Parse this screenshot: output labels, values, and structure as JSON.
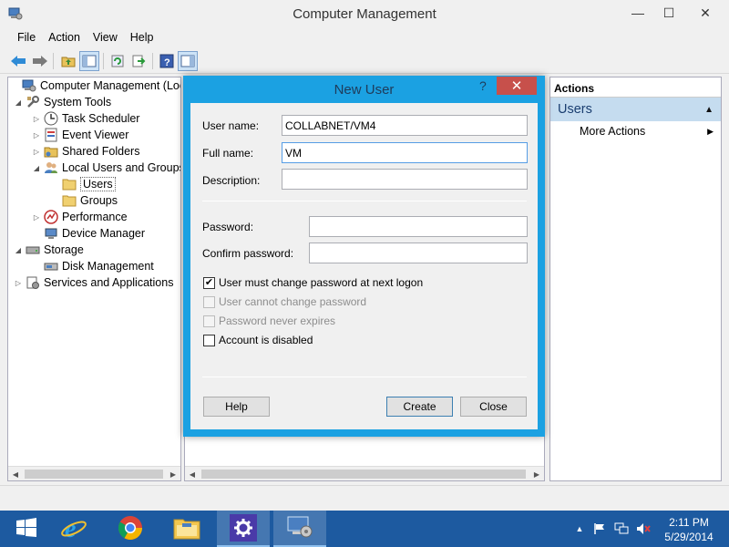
{
  "window": {
    "title": "Computer Management",
    "controls": {
      "minimize": "—",
      "maximize": "☐",
      "close": "✕"
    }
  },
  "menu": [
    "File",
    "Action",
    "View",
    "Help"
  ],
  "tree": {
    "items": [
      {
        "label": "Computer Management (Local",
        "level": 0,
        "arrow": "",
        "icon": "computer-management-icon"
      },
      {
        "label": "System Tools",
        "level": 0,
        "arrow": "◢",
        "icon": "tools-icon"
      },
      {
        "label": "Task Scheduler",
        "level": 1,
        "arrow": "▷",
        "icon": "clock-icon"
      },
      {
        "label": "Event Viewer",
        "level": 1,
        "arrow": "▷",
        "icon": "event-viewer-icon"
      },
      {
        "label": "Shared Folders",
        "level": 1,
        "arrow": "▷",
        "icon": "shared-folder-icon"
      },
      {
        "label": "Local Users and Groups",
        "level": 1,
        "arrow": "◢",
        "icon": "users-icon"
      },
      {
        "label": "Users",
        "level": 2,
        "arrow": "",
        "icon": "folder-icon",
        "selected": true
      },
      {
        "label": "Groups",
        "level": 2,
        "arrow": "",
        "icon": "folder-icon"
      },
      {
        "label": "Performance",
        "level": 1,
        "arrow": "▷",
        "icon": "performance-icon"
      },
      {
        "label": "Device Manager",
        "level": 1,
        "arrow": "",
        "icon": "device-manager-icon"
      },
      {
        "label": "Storage",
        "level": 0,
        "arrow": "◢",
        "icon": "storage-icon"
      },
      {
        "label": "Disk Management",
        "level": 1,
        "arrow": "",
        "icon": "disk-icon"
      },
      {
        "label": "Services and Applications",
        "level": 0,
        "arrow": "▷",
        "icon": "services-icon"
      }
    ]
  },
  "actions": {
    "header": "Actions",
    "section": "Users",
    "section_arrow": "▲",
    "more": "More Actions",
    "more_arrow": "▶"
  },
  "dialog": {
    "title": "New User",
    "help_glyph": "?",
    "close_glyph": "✕",
    "fields": {
      "user_name": {
        "label": "User name:",
        "value": "COLLABNET/VM4"
      },
      "full_name": {
        "label": "Full name:",
        "value": "VM"
      },
      "description": {
        "label": "Description:",
        "value": ""
      },
      "password": {
        "label": "Password:",
        "value": ""
      },
      "confirm_password": {
        "label": "Confirm password:",
        "value": ""
      }
    },
    "checkboxes": [
      {
        "label": "User must change password at next logon",
        "checked": true,
        "enabled": true
      },
      {
        "label": "User cannot change password",
        "checked": false,
        "enabled": false
      },
      {
        "label": "Password never expires",
        "checked": false,
        "enabled": false
      },
      {
        "label": "Account is disabled",
        "checked": false,
        "enabled": true
      }
    ],
    "buttons": {
      "help": "Help",
      "create": "Create",
      "close": "Close"
    }
  },
  "taskbar": {
    "apps": [
      "start-icon",
      "internet-explorer-icon",
      "chrome-icon",
      "file-explorer-icon",
      "control-panel-icon",
      "computer-management-icon"
    ],
    "clock": {
      "time": "2:11 PM",
      "date": "5/29/2014"
    }
  },
  "colors": {
    "dialog_border": "#1ba1e2",
    "taskbar": "#1d5aa0",
    "close_red": "#c7504b",
    "section_bg": "#c5dcef"
  }
}
